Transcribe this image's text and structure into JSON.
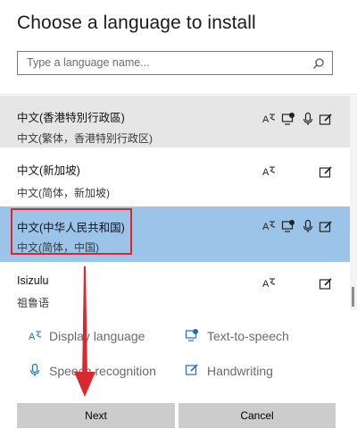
{
  "dialog": {
    "title": "Choose a language to install",
    "search_placeholder": "Type a language name..."
  },
  "languages": [
    {
      "name": "中文(香港特別行政區)",
      "subtitle": "中文(繁体，香港特别行政区)",
      "features": [
        "display-language",
        "text-to-speech",
        "speech-recognition",
        "handwriting"
      ]
    },
    {
      "name": "中文(新加坡)",
      "subtitle": "中文(简体，新加坡)",
      "features": [
        "display-language",
        "handwriting"
      ]
    },
    {
      "name": "中文(中华人民共和国)",
      "subtitle": "中文(简体，中国)",
      "features": [
        "display-language",
        "text-to-speech",
        "speech-recognition",
        "handwriting"
      ],
      "selected": true
    },
    {
      "name": "Isizulu",
      "subtitle": "祖鲁语",
      "features": [
        "display-language",
        "handwriting"
      ]
    }
  ],
  "legend": {
    "display_language": "Display language",
    "text_to_speech": "Text-to-speech",
    "speech_recognition": "Speech recognition",
    "handwriting": "Handwriting"
  },
  "buttons": {
    "next": "Next",
    "cancel": "Cancel"
  },
  "colors": {
    "selected_row": "#9cc3e8",
    "hover_row": "#e6e6e6",
    "annotation_red": "#d9282f"
  }
}
